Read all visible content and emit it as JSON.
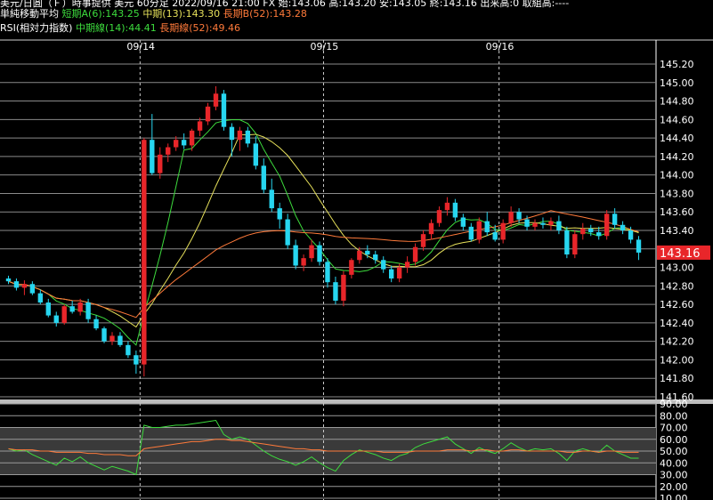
{
  "header": {
    "line1": "美元/日圓（Ｆ）時事提供 美元 60分足 2022/09/16 21:00 FX 始:143.06 高:143.20 安:143.05 終:143.16 出来高:0 取組高:----",
    "ma_title": "単純移動平均",
    "ma_short": "短期A(6):143.25",
    "ma_mid": "中期(13):143.30",
    "ma_long": "長期B(52):143.28",
    "rsi_title": "RSI(相対力指数)",
    "rsi_mid": "中期線(14):44.41",
    "rsi_long": "長期線(52):49.46"
  },
  "colors": {
    "up": "#e8262a",
    "down": "#27d6f0",
    "ma_short": "#3ddc3d",
    "ma_mid": "#e6e05a",
    "ma_long": "#ff7a3a",
    "current_price_bg": "#e8262a"
  },
  "current_price": "143.16",
  "chart_data": [
    {
      "type": "candlestick",
      "title": "USD/JPY 60分足",
      "dates": [
        "09/14",
        "09/15",
        "09/16"
      ],
      "ylim": [
        141.6,
        145.2
      ],
      "yticks": [
        "145.20",
        "145.00",
        "144.80",
        "144.60",
        "144.40",
        "144.20",
        "144.00",
        "143.80",
        "143.60",
        "143.40",
        "143.20",
        "143.00",
        "142.80",
        "142.60",
        "142.40",
        "142.20",
        "142.00",
        "141.80",
        "141.60"
      ],
      "candles": [
        [
          142.88,
          142.91,
          142.82,
          142.85
        ],
        [
          142.85,
          142.88,
          142.75,
          142.78
        ],
        [
          142.78,
          142.86,
          142.7,
          142.82
        ],
        [
          142.82,
          142.85,
          142.7,
          142.72
        ],
        [
          142.72,
          142.76,
          142.6,
          142.62
        ],
        [
          142.62,
          142.66,
          142.46,
          142.48
        ],
        [
          142.48,
          142.52,
          142.36,
          142.4
        ],
        [
          142.4,
          142.6,
          142.38,
          142.58
        ],
        [
          142.58,
          142.64,
          142.5,
          142.52
        ],
        [
          142.52,
          142.66,
          142.48,
          142.62
        ],
        [
          142.62,
          142.66,
          142.4,
          142.44
        ],
        [
          142.44,
          142.48,
          142.32,
          142.34
        ],
        [
          142.34,
          142.36,
          142.18,
          142.2
        ],
        [
          142.2,
          142.3,
          142.16,
          142.26
        ],
        [
          142.26,
          142.3,
          142.14,
          142.16
        ],
        [
          142.16,
          142.2,
          142.02,
          142.05
        ],
        [
          142.05,
          142.1,
          141.85,
          141.95
        ],
        [
          141.95,
          144.4,
          141.82,
          144.38
        ],
        [
          144.38,
          144.66,
          144.0,
          144.02
        ],
        [
          144.02,
          144.3,
          143.96,
          144.22
        ],
        [
          144.22,
          144.34,
          144.14,
          144.3
        ],
        [
          144.3,
          144.42,
          144.26,
          144.38
        ],
        [
          144.38,
          144.45,
          144.28,
          144.32
        ],
        [
          144.32,
          144.5,
          144.26,
          144.48
        ],
        [
          144.48,
          144.62,
          144.42,
          144.58
        ],
        [
          144.58,
          144.78,
          144.54,
          144.74
        ],
        [
          144.74,
          144.96,
          144.7,
          144.88
        ],
        [
          144.88,
          144.92,
          144.48,
          144.52
        ],
        [
          144.52,
          144.56,
          144.2,
          144.38
        ],
        [
          144.38,
          144.52,
          144.26,
          144.48
        ],
        [
          144.48,
          144.52,
          144.3,
          144.34
        ],
        [
          144.34,
          144.42,
          144.06,
          144.1
        ],
        [
          144.1,
          144.18,
          143.8,
          143.84
        ],
        [
          143.84,
          143.96,
          143.6,
          143.64
        ],
        [
          143.64,
          143.7,
          143.42,
          143.52
        ],
        [
          143.52,
          143.58,
          143.2,
          143.24
        ],
        [
          143.24,
          143.3,
          142.98,
          143.02
        ],
        [
          143.02,
          143.14,
          142.96,
          143.1
        ],
        [
          143.1,
          143.3,
          143.06,
          143.24
        ],
        [
          143.24,
          143.28,
          143.02,
          143.06
        ],
        [
          143.06,
          143.1,
          142.78,
          142.84
        ],
        [
          142.84,
          142.9,
          142.6,
          142.64
        ],
        [
          142.64,
          142.96,
          142.58,
          142.92
        ],
        [
          142.92,
          143.1,
          142.88,
          143.08
        ],
        [
          143.08,
          143.22,
          143.04,
          143.18
        ],
        [
          143.18,
          143.24,
          143.1,
          143.14
        ],
        [
          143.14,
          143.18,
          143.04,
          143.08
        ],
        [
          143.08,
          143.12,
          142.94,
          142.98
        ],
        [
          142.98,
          143.02,
          142.84,
          142.88
        ],
        [
          142.88,
          143.04,
          142.84,
          143.0
        ],
        [
          143.0,
          143.12,
          142.94,
          143.06
        ],
        [
          143.06,
          143.26,
          143.02,
          143.22
        ],
        [
          143.22,
          143.4,
          143.18,
          143.36
        ],
        [
          143.36,
          143.52,
          143.3,
          143.48
        ],
        [
          143.48,
          143.66,
          143.44,
          143.62
        ],
        [
          143.62,
          143.76,
          143.56,
          143.7
        ],
        [
          143.7,
          143.74,
          143.5,
          143.54
        ],
        [
          143.54,
          143.58,
          143.4,
          143.44
        ],
        [
          143.44,
          143.48,
          143.28,
          143.3
        ],
        [
          143.3,
          143.54,
          143.26,
          143.5
        ],
        [
          143.5,
          143.6,
          143.34,
          143.38
        ],
        [
          143.38,
          143.46,
          143.28,
          143.3
        ],
        [
          143.3,
          143.52,
          143.26,
          143.48
        ],
        [
          143.48,
          143.66,
          143.44,
          143.6
        ],
        [
          143.6,
          143.64,
          143.48,
          143.52
        ],
        [
          143.52,
          143.56,
          143.4,
          143.44
        ],
        [
          143.44,
          143.52,
          143.4,
          143.48
        ],
        [
          143.48,
          143.54,
          143.42,
          143.46
        ],
        [
          143.46,
          143.54,
          143.4,
          143.5
        ],
        [
          143.5,
          143.56,
          143.36,
          143.4
        ],
        [
          143.4,
          143.44,
          143.1,
          143.14
        ],
        [
          143.14,
          143.4,
          143.1,
          143.36
        ],
        [
          143.36,
          143.48,
          143.3,
          143.42
        ],
        [
          143.42,
          143.46,
          143.34,
          143.38
        ],
        [
          143.38,
          143.44,
          143.3,
          143.34
        ],
        [
          143.34,
          143.62,
          143.3,
          143.58
        ],
        [
          143.58,
          143.64,
          143.42,
          143.46
        ],
        [
          143.46,
          143.5,
          143.36,
          143.4
        ],
        [
          143.4,
          143.44,
          143.26,
          143.3
        ],
        [
          143.3,
          143.34,
          143.08,
          143.16
        ]
      ],
      "x_range_hours": [
        0,
        80
      ],
      "date_line_positions_hours": [
        17,
        40,
        62
      ]
    },
    {
      "type": "line",
      "title": "RSI",
      "ylim": [
        10,
        90
      ],
      "yticks": [
        "90.00",
        "80.00",
        "70.00",
        "60.00",
        "50.00",
        "40.00",
        "30.00",
        "20.00",
        "10.00"
      ],
      "series": [
        {
          "name": "中期線(14)",
          "color": "#3ddc3d",
          "values": [
            52,
            50,
            51,
            47,
            44,
            41,
            38,
            44,
            41,
            45,
            40,
            37,
            34,
            37,
            35,
            33,
            30,
            72,
            70,
            70,
            71,
            72,
            72,
            73,
            74,
            75,
            76,
            64,
            60,
            62,
            60,
            55,
            50,
            46,
            43,
            41,
            38,
            41,
            45,
            40,
            36,
            33,
            42,
            47,
            51,
            49,
            47,
            44,
            42,
            46,
            48,
            53,
            56,
            58,
            60,
            62,
            56,
            52,
            48,
            53,
            50,
            48,
            52,
            57,
            53,
            50,
            52,
            51,
            52,
            48,
            42,
            50,
            52,
            50,
            49,
            55,
            50,
            47,
            44,
            44
          ]
        },
        {
          "name": "長期線(52)",
          "color": "#ff7a3a",
          "values": [
            52,
            51,
            51,
            51,
            50,
            50,
            49,
            49,
            49,
            49,
            48,
            48,
            47,
            47,
            47,
            46,
            46,
            52,
            53,
            54,
            55,
            56,
            57,
            58,
            58,
            59,
            60,
            60,
            59,
            59,
            58,
            57,
            56,
            55,
            54,
            53,
            52,
            52,
            51,
            51,
            50,
            50,
            50,
            50,
            50,
            50,
            50,
            49,
            49,
            49,
            49,
            50,
            50,
            50,
            50,
            51,
            51,
            51,
            50,
            51,
            51,
            50,
            50,
            51,
            51,
            50,
            50,
            50,
            50,
            50,
            49,
            49,
            50,
            50,
            49,
            50,
            50,
            49,
            49,
            49
          ]
        }
      ]
    }
  ]
}
